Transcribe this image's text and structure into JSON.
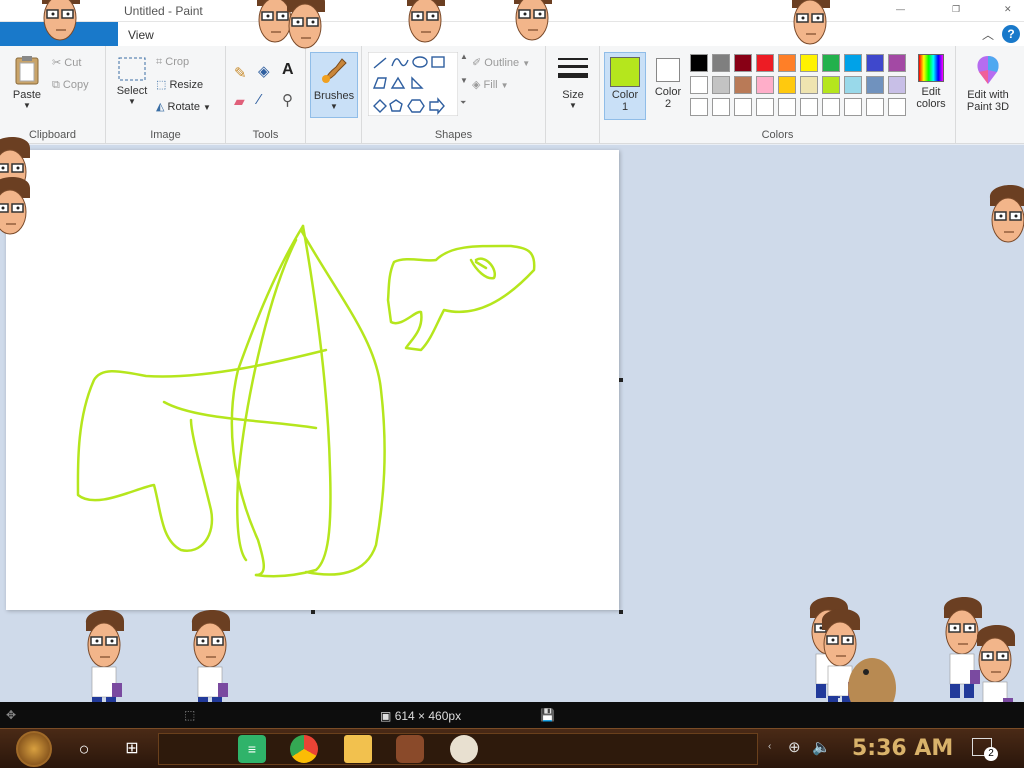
{
  "window": {
    "title": "Untitled - Paint",
    "controls": [
      "—",
      "❐",
      "✕"
    ]
  },
  "menu": {
    "view_label": "View",
    "help_label": "?",
    "collapse_label": "︿"
  },
  "ribbon": {
    "clipboard": {
      "label": "Clipboard",
      "paste": "Paste",
      "cut": "Cut",
      "copy": "Copy"
    },
    "image": {
      "label": "Image",
      "select": "Select",
      "crop": "Crop",
      "resize": "Resize",
      "rotate": "Rotate"
    },
    "tools": {
      "label": "Tools"
    },
    "brushes": {
      "label": "Brushes"
    },
    "shapes": {
      "label": "Shapes",
      "outline": "Outline",
      "fill": "Fill"
    },
    "size": {
      "label": "Size"
    },
    "colors": {
      "label": "Colors",
      "color1": "Color 1",
      "color1_line1": "Color",
      "color1_line2": "1",
      "color2_line1": "Color",
      "color2_line2": "2",
      "edit_line1": "Edit",
      "edit_line2": "colors",
      "paint3d_line1": "Edit with",
      "paint3d_line2": "Paint 3D",
      "active_color": "#b5e61d",
      "secondary_color": "#ffffff",
      "palette_row1": [
        "#000000",
        "#7f7f7f",
        "#880015",
        "#ed1c24",
        "#ff7f27",
        "#fff200",
        "#22b14c",
        "#00a2e8",
        "#3f48cc",
        "#a349a4"
      ],
      "palette_row2": [
        "#ffffff",
        "#c3c3c3",
        "#b97a57",
        "#ffaec9",
        "#ffc90e",
        "#efe4b0",
        "#b5e61d",
        "#99d9ea",
        "#7092be",
        "#c8bfe7"
      ],
      "palette_row3": [
        "#ffffff",
        "#ffffff",
        "#ffffff",
        "#ffffff",
        "#ffffff",
        "#ffffff",
        "#ffffff",
        "#ffffff",
        "#ffffff",
        "#ffffff"
      ]
    }
  },
  "status": {
    "canvas_size": "614 × 460px"
  },
  "taskbar": {
    "time": "5:36 AM",
    "notification_count": "2"
  },
  "drawing": {
    "stroke_color": "#b5e61d"
  }
}
